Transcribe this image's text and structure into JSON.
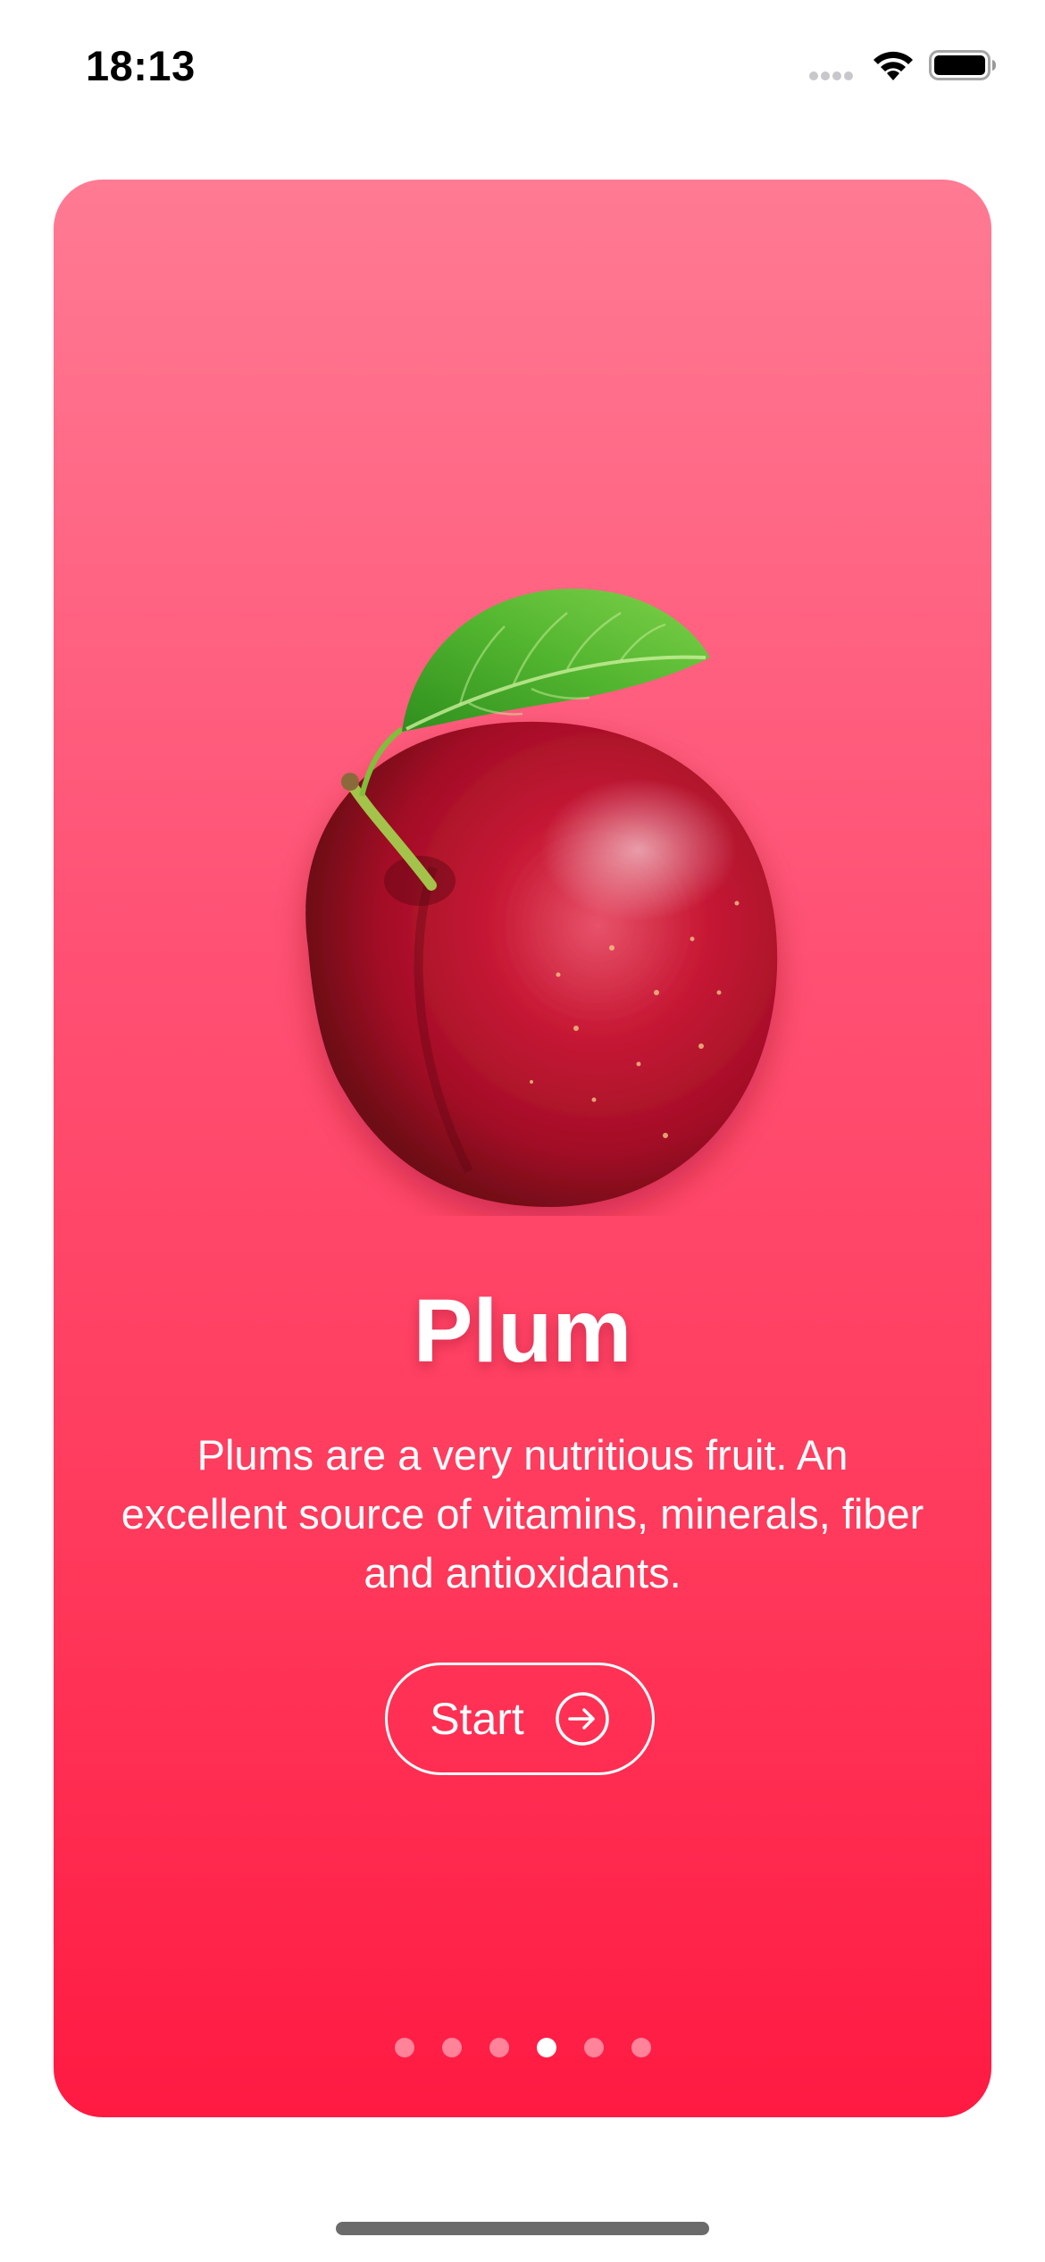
{
  "status_bar": {
    "time": "18:13",
    "signal_icon": "cellular-signal-icon",
    "wifi_icon": "wifi-icon",
    "battery_icon": "battery-icon"
  },
  "card": {
    "gradient_top": "#ff7a93",
    "gradient_bottom": "#ff1a42",
    "image_icon": "plum-fruit-image",
    "title": "Plum",
    "description": "Plums are a very nutritious fruit. An excellent source of vitamins, minerals, fiber and antioxidants.",
    "start_button": {
      "label": "Start",
      "icon": "arrow-right-circle-icon"
    },
    "pagination": {
      "total": 6,
      "active_index": 3
    }
  }
}
